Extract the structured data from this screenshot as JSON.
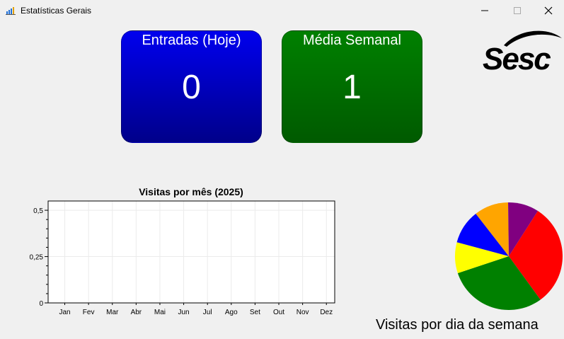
{
  "window": {
    "title": "Estatísticas Gerais",
    "icon": "app-chart-icon"
  },
  "cards": {
    "today": {
      "title": "Entradas (Hoje)",
      "value": "0",
      "color": "#0000dd"
    },
    "weekly": {
      "title": "Média Semanal",
      "value": "1",
      "color": "#007000"
    }
  },
  "logo": {
    "text": "Sesc"
  },
  "chart_data": [
    {
      "type": "line",
      "title": "Visitas por mês (2025)",
      "xlabel": "",
      "ylabel": "",
      "categories": [
        "Jan",
        "Fev",
        "Mar",
        "Abr",
        "Mai",
        "Jun",
        "Jul",
        "Ago",
        "Set",
        "Out",
        "Nov",
        "Dez"
      ],
      "values": [
        0,
        0,
        0,
        0,
        0,
        0,
        0,
        0,
        0,
        0,
        0,
        0
      ],
      "yticks": [
        "0",
        "0,25",
        "0,5"
      ],
      "ylim": [
        0,
        0.55
      ],
      "grid": true
    },
    {
      "type": "pie",
      "title": "Visitas por dia da semana",
      "slices": [
        {
          "value": 30,
          "color": "#ff0000"
        },
        {
          "value": 29,
          "color": "#008000"
        },
        {
          "value": 9,
          "color": "#ffff00"
        },
        {
          "value": 10,
          "color": "#0000ff"
        },
        {
          "value": 10,
          "color": "#ffa500"
        },
        {
          "value": 9,
          "color": "#800080"
        }
      ]
    }
  ]
}
